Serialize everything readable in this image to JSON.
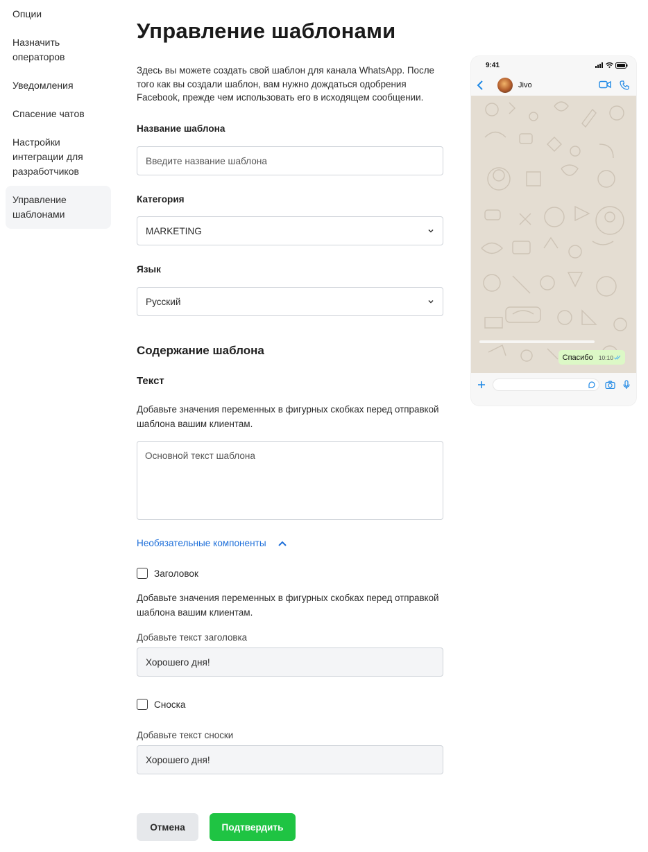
{
  "sidebar": {
    "items": [
      {
        "label": "Опции"
      },
      {
        "label": "Назначить операторов"
      },
      {
        "label": "Уведомления"
      },
      {
        "label": "Спасение чатов"
      },
      {
        "label": "Настройки интеграции для разработчиков"
      },
      {
        "label": "Управление шаблонами",
        "active": true
      }
    ]
  },
  "main": {
    "title": "Управление шаблонами",
    "intro": "Здесь вы можете создать свой шаблон для канала WhatsApp. После того как вы создали шаблон, вам нужно дождаться одобрения Facebook, прежде чем использовать его в исходящем сообщении.",
    "template_name": {
      "label": "Название шаблона",
      "placeholder": "Введите название шаблона"
    },
    "category": {
      "label": "Категория",
      "value": "MARKETING"
    },
    "language": {
      "label": "Язык",
      "value": "Русский"
    },
    "content_title": "Содержание шаблона",
    "text": {
      "label": "Текст",
      "hint": "Добавьте значения переменных в фигурных скобках перед отправкой шаблона вашим клиентам.",
      "placeholder": "Основной текст шаблона"
    },
    "optional": {
      "label": "Необязательные компоненты"
    },
    "header": {
      "checkbox_label": "Заголовок",
      "hint": "Добавьте значения переменных в фигурных скобках перед отправкой шаблона вашим клиентам.",
      "field_label": "Добавьте текст заголовка",
      "value": "Хорошего дня!"
    },
    "footer": {
      "checkbox_label": "Сноска",
      "field_label": "Добавьте текст сноски",
      "value": "Хорошего дня!"
    },
    "buttons": {
      "cancel": "Отмена",
      "confirm": "Подтвердить"
    }
  },
  "preview": {
    "time": "9:41",
    "contact": "Jivo",
    "message": "Спасибо",
    "message_time": "10:10"
  },
  "colors": {
    "accent": "#1fc443",
    "link": "#1e6fd9",
    "ios_blue": "#1e88e5"
  }
}
